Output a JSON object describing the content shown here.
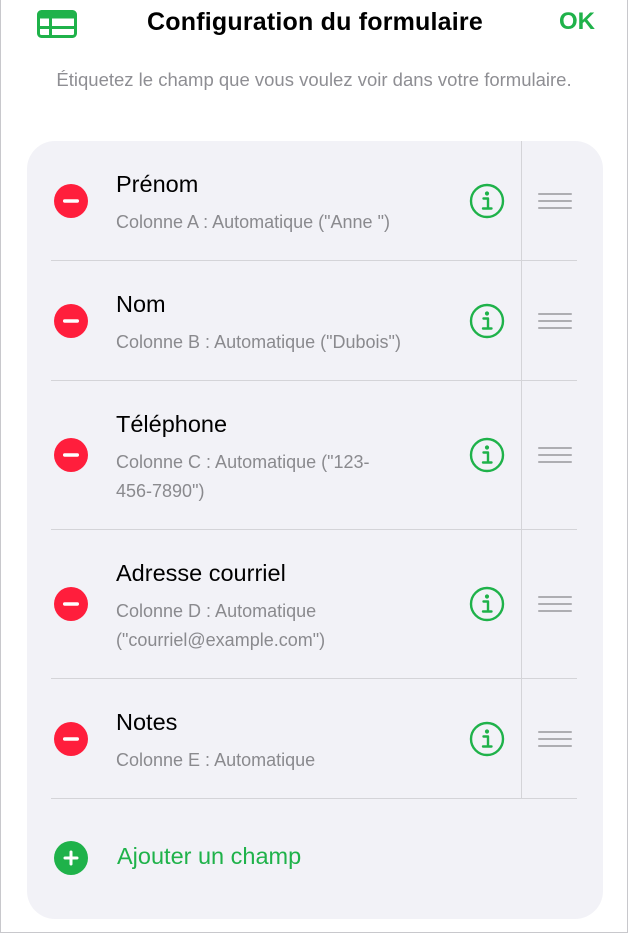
{
  "header": {
    "table_icon": "table-grid-icon",
    "title": "Configuration du formulaire",
    "ok_label": "OK"
  },
  "instructions": "Étiquetez le champ que vous voulez voir dans votre formulaire.",
  "fields": [
    {
      "name": "Prénom",
      "description": "Colonne A : Automatique (\"Anne \")"
    },
    {
      "name": "Nom",
      "description": "Colonne B : Automatique (\"Dubois\")"
    },
    {
      "name": "Téléphone",
      "description": "Colonne C : Automatique (\"123-456-7890\")"
    },
    {
      "name": "Adresse courriel",
      "description": "Colonne D : Automatique (\"courriel@example.com\")"
    },
    {
      "name": "Notes",
      "description": "Colonne E : Automatique"
    }
  ],
  "add_field_label": "Ajouter un champ",
  "icons": {
    "delete": "minus-circle-icon",
    "info": "info-circle-icon",
    "reorder": "drag-handle-icon",
    "add": "plus-circle-icon"
  },
  "colors": {
    "accent": "#1fb24a",
    "delete": "#ff1e3c",
    "card_background": "#f2f2f7",
    "secondary_text": "#8a8a8e"
  }
}
